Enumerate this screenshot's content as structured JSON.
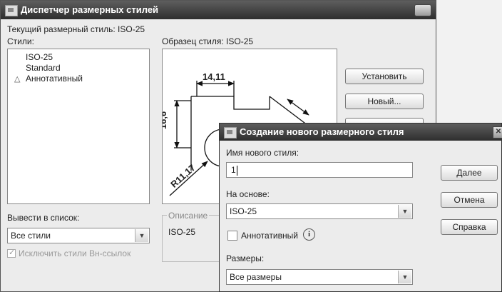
{
  "main_dialog": {
    "title": "Диспетчер размерных стилей",
    "current_style_label": "Текущий размерный стиль: ISO-25",
    "styles_label": "Стили:",
    "styles": [
      {
        "name": "ISO-25",
        "annotative": false
      },
      {
        "name": "Standard",
        "annotative": false
      },
      {
        "name": "Аннотативный",
        "annotative": true
      }
    ],
    "preview_label": "Образец стиля: ISO-25",
    "preview": {
      "dim_top": "14,11",
      "dim_left": "16,6",
      "dim_radius": "R11,17"
    },
    "buttons": {
      "set_current": "Установить",
      "new": "Новый..."
    },
    "list_filter_label": "Вывести в список:",
    "list_filter_value": "Все стили",
    "exclude_xrefs_label": "Исключить стили Вн-ссылок",
    "description_label": "Описание",
    "description_value": "ISO-25"
  },
  "new_style_dialog": {
    "title": "Создание нового размерного стиля",
    "new_name_label": "Имя нового стиля:",
    "new_name_value": "1",
    "based_on_label": "На основе:",
    "based_on_value": "ISO-25",
    "annotative_label": "Аннотативный",
    "use_for_label": "Размеры:",
    "use_for_value": "Все размеры",
    "buttons": {
      "continue": "Далее",
      "cancel": "Отмена",
      "help": "Справка"
    }
  }
}
